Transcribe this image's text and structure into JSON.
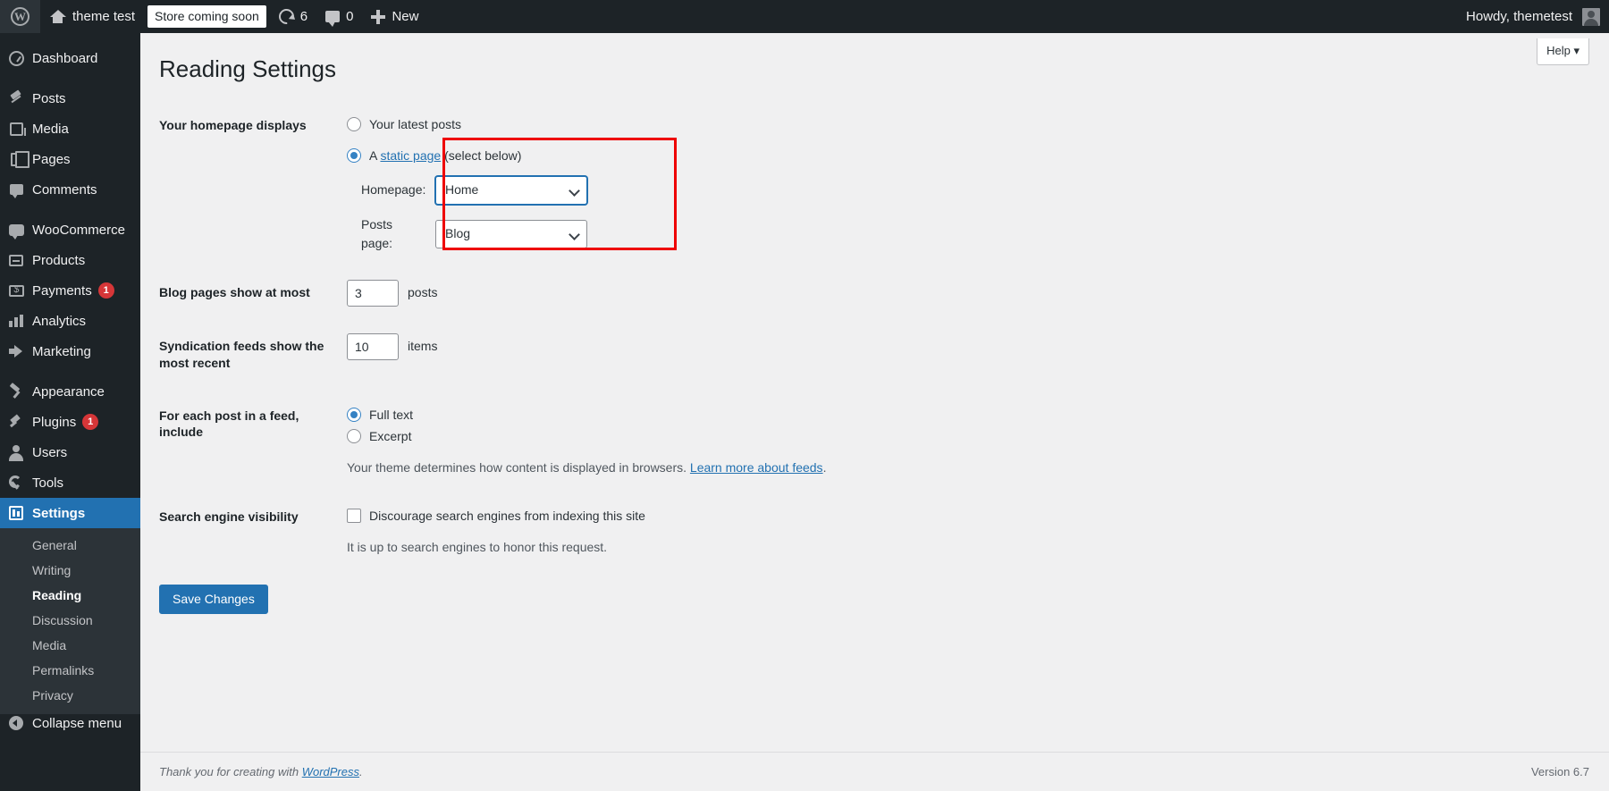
{
  "adminbar": {
    "logo_icon": "wordpress-logo-icon",
    "site_name": "theme test",
    "site_home_icon": "home-icon",
    "coming_soon_badge": "Store coming soon",
    "updates_icon": "updates-icon",
    "updates_count": "6",
    "comments_icon": "comments-icon",
    "comments_count": "0",
    "new_icon": "plus-icon",
    "new_label": "New",
    "howdy": "Howdy, themetest",
    "avatar_icon": "avatar-icon"
  },
  "sidebar": {
    "items": [
      {
        "label": "Dashboard",
        "icon": "dashboard-icon",
        "badge": ""
      },
      {
        "label": "Posts",
        "icon": "posts-pin-icon",
        "badge": ""
      },
      {
        "label": "Media",
        "icon": "media-icon",
        "badge": ""
      },
      {
        "label": "Pages",
        "icon": "pages-icon",
        "badge": ""
      },
      {
        "label": "Comments",
        "icon": "comments-icon",
        "badge": ""
      },
      {
        "label": "WooCommerce",
        "icon": "woocommerce-icon",
        "badge": ""
      },
      {
        "label": "Products",
        "icon": "products-icon",
        "badge": ""
      },
      {
        "label": "Payments",
        "icon": "payments-icon",
        "badge": "1"
      },
      {
        "label": "Analytics",
        "icon": "analytics-bars-icon",
        "badge": ""
      },
      {
        "label": "Marketing",
        "icon": "marketing-megaphone-icon",
        "badge": ""
      },
      {
        "label": "Appearance",
        "icon": "appearance-brush-icon",
        "badge": ""
      },
      {
        "label": "Plugins",
        "icon": "plugins-icon",
        "badge": "1"
      },
      {
        "label": "Users",
        "icon": "users-icon",
        "badge": ""
      },
      {
        "label": "Tools",
        "icon": "tools-wrench-icon",
        "badge": ""
      },
      {
        "label": "Settings",
        "icon": "settings-icon",
        "badge": ""
      }
    ],
    "submenu": [
      {
        "label": "General"
      },
      {
        "label": "Writing"
      },
      {
        "label": "Reading"
      },
      {
        "label": "Discussion"
      },
      {
        "label": "Media"
      },
      {
        "label": "Permalinks"
      },
      {
        "label": "Privacy"
      }
    ],
    "collapse_label": "Collapse menu",
    "collapse_icon": "collapse-arrow-icon",
    "current_item": "Settings",
    "current_subitem": "Reading"
  },
  "page": {
    "title": "Reading Settings",
    "help_tab_label": "Help",
    "help_tab_icon": "chevron-down-icon"
  },
  "settings": {
    "homepage_displays": {
      "label": "Your homepage displays",
      "latest_posts_label": "Your latest posts",
      "latest_posts_checked": false,
      "static_page_prefix": "A ",
      "static_page_link": "static page",
      "static_page_suffix": " (select below)",
      "static_page_checked": true,
      "homepage_select_label": "Homepage:",
      "homepage_select_value": "Home",
      "homepage_select_focused": true,
      "posts_select_label": "Posts page:",
      "posts_select_value": "Blog",
      "select_chevron_icon": "chevron-down-icon"
    },
    "blog_pages": {
      "label": "Blog pages show at most",
      "value": "3",
      "unit": "posts"
    },
    "syndication": {
      "label": "Syndication feeds show the most recent",
      "value": "10",
      "unit": "items"
    },
    "feed_include": {
      "label": "For each post in a feed, include",
      "full_text_label": "Full text",
      "full_text_checked": true,
      "excerpt_label": "Excerpt",
      "excerpt_checked": false,
      "description_prefix": "Your theme determines how content is displayed in browsers. ",
      "description_link": "Learn more about feeds",
      "description_suffix": "."
    },
    "search_visibility": {
      "label": "Search engine visibility",
      "checkbox_label": "Discourage search engines from indexing this site",
      "checked": false,
      "note": "It is up to search engines to honor this request."
    },
    "save_button": "Save Changes"
  },
  "footer": {
    "thanks_prefix": "Thank you for creating with ",
    "thanks_link": "WordPress",
    "thanks_suffix": ".",
    "version": "Version 6.7"
  },
  "colors": {
    "admin_bar_bg": "#1d2327",
    "sidebar_bg": "#1d2327",
    "submenu_bg": "#2c3338",
    "accent_blue": "#2271b1",
    "link_blue": "#2271b1",
    "badge_red": "#d63638",
    "annotation_red": "#ee0000",
    "content_bg": "#f0f0f1"
  }
}
